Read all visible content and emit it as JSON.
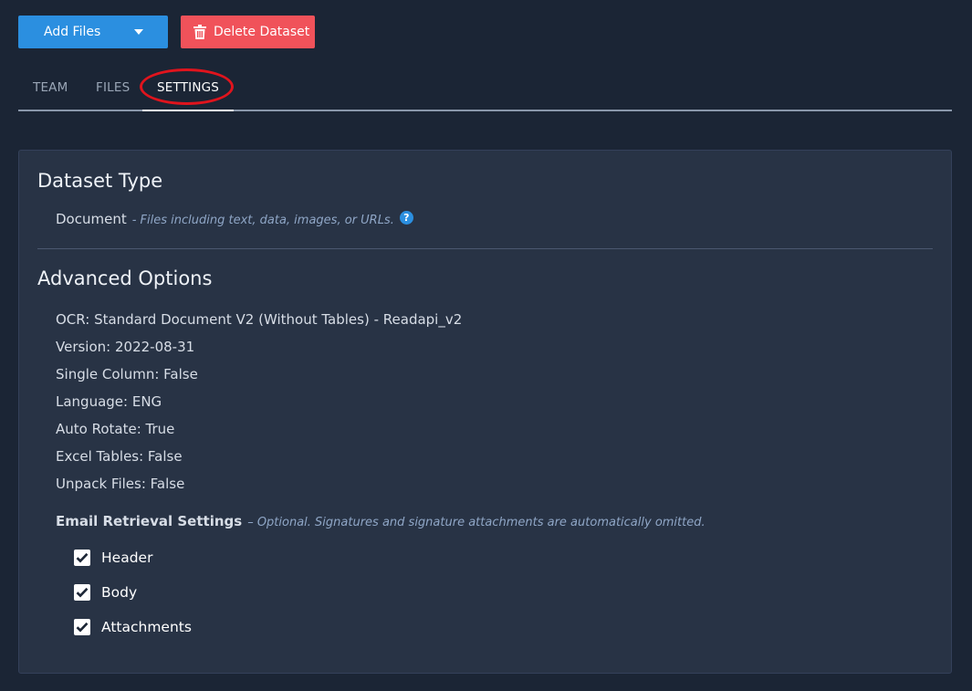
{
  "toolbar": {
    "add_files_label": "Add Files",
    "delete_dataset_label": "Delete Dataset"
  },
  "tabs": [
    {
      "label": "TEAM",
      "active": false
    },
    {
      "label": "FILES",
      "active": false
    },
    {
      "label": "SETTINGS",
      "active": true
    }
  ],
  "dataset_type": {
    "heading": "Dataset Type",
    "type_name": "Document",
    "type_description": "- Files including text, data, images, or URLs.",
    "help_icon": "?"
  },
  "advanced_options": {
    "heading": "Advanced Options",
    "items": [
      "OCR: Standard Document V2 (Without Tables) - Readapi_v2",
      "Version: 2022-08-31",
      "Single Column: False",
      "Language: ENG",
      "Auto Rotate: True",
      "Excel Tables: False",
      "Unpack Files: False"
    ]
  },
  "email_retrieval": {
    "label": "Email Retrieval Settings",
    "description": "– Optional. Signatures and signature attachments are automatically omitted.",
    "options": [
      {
        "label": "Header",
        "checked": true
      },
      {
        "label": "Body",
        "checked": true
      },
      {
        "label": "Attachments",
        "checked": true
      }
    ]
  },
  "colors": {
    "background": "#1b2535",
    "card": "#283345",
    "primary_button": "#2b8fe0",
    "danger_button": "#f0525a",
    "annotation_circle": "#e0141d"
  }
}
